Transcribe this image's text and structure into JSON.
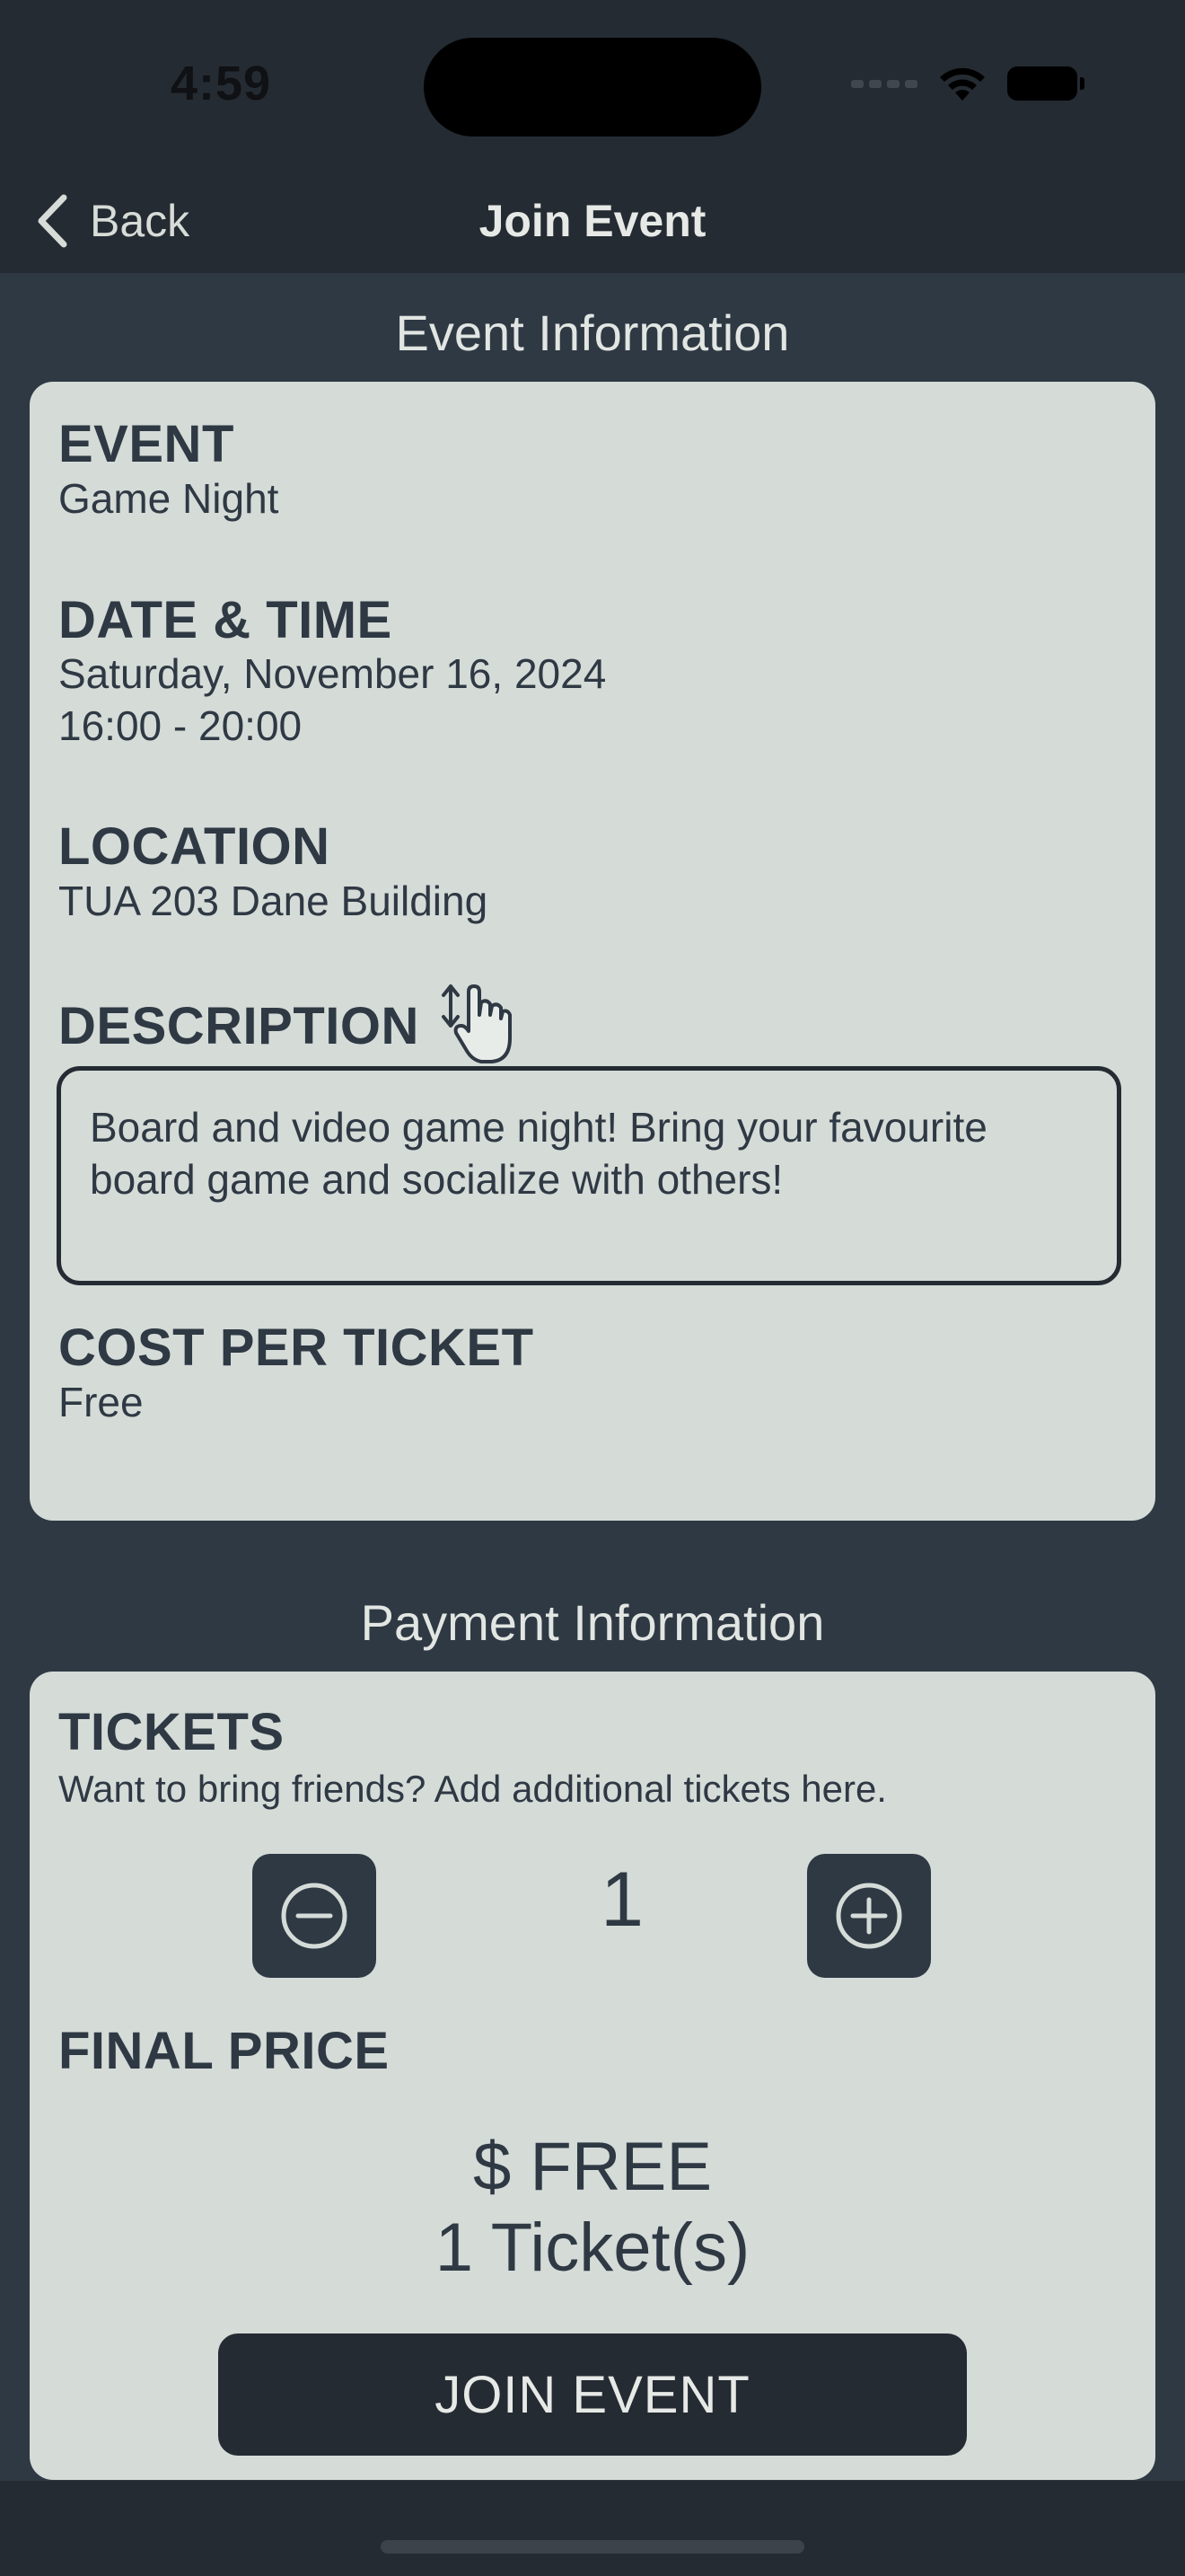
{
  "status_bar": {
    "time": "4:59"
  },
  "nav": {
    "back_label": "Back",
    "title": "Join Event"
  },
  "event_section": {
    "title": "Event Information",
    "event_label": "EVENT",
    "event_value": "Game Night",
    "datetime_label": "DATE & TIME",
    "date_value": "Saturday, November 16, 2024",
    "time_value": "16:00 - 20:00",
    "location_label": "LOCATION",
    "location_value": "TUA 203 Dane Building",
    "description_label": "DESCRIPTION",
    "description_value": "Board and video game night! Bring your favourite board game and socialize with others!",
    "cost_label": "COST PER TICKET",
    "cost_value": "Free"
  },
  "payment_section": {
    "title": "Payment Information",
    "tickets_label": "TICKETS",
    "tickets_hint": "Want to bring friends? Add additional tickets here.",
    "ticket_count": "1",
    "final_price_label": "FINAL PRICE",
    "final_price_value": "$ FREE",
    "final_ticket_summary": "1 Ticket(s)",
    "join_button_label": "JOIN EVENT"
  },
  "colors": {
    "background": "#2f3944",
    "bar": "#252b32",
    "card": "#d5dbd7",
    "text_dark": "#2f3944",
    "text_light": "#e2e6e2"
  }
}
